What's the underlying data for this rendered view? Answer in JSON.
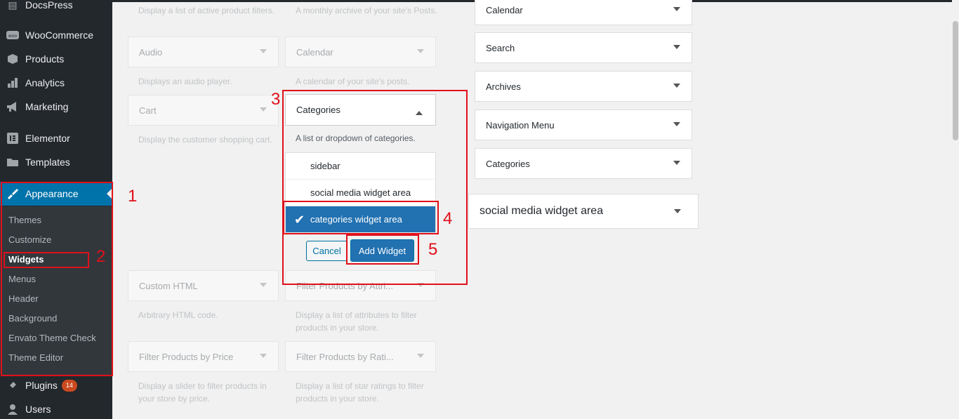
{
  "sidebar": {
    "items": [
      {
        "label": "DocsPress",
        "icon": "docs-icon"
      },
      {
        "label": "WooCommerce",
        "icon": "woo-icon"
      },
      {
        "label": "Products",
        "icon": "box-icon"
      },
      {
        "label": "Analytics",
        "icon": "bar-chart-icon"
      },
      {
        "label": "Marketing",
        "icon": "megaphone-icon"
      },
      {
        "label": "Elementor",
        "icon": "elementor-icon"
      },
      {
        "label": "Templates",
        "icon": "folder-icon"
      },
      {
        "label": "Appearance",
        "icon": "brush-icon"
      },
      {
        "label": "Plugins",
        "icon": "plug-icon",
        "badge": "14"
      },
      {
        "label": "Users",
        "icon": "user-icon"
      }
    ],
    "submenu": [
      "Themes",
      "Customize",
      "Widgets",
      "Menus",
      "Header",
      "Background",
      "Envato Theme Check",
      "Theme Editor"
    ]
  },
  "available_widgets": {
    "col1": [
      {
        "desc": "Display a list of active product filters."
      },
      {
        "title": "Audio",
        "desc": "Displays an audio player."
      },
      {
        "title": "Cart",
        "desc": "Display the customer shopping cart."
      },
      {
        "title": "Custom HTML",
        "desc": "Arbitrary HTML code."
      },
      {
        "title": "Filter Products by Price",
        "desc": "Display a slider to filter products in your store by price."
      }
    ],
    "col2": [
      {
        "desc": "A monthly archive of your site's Posts."
      },
      {
        "title": "Calendar",
        "desc": "A calendar of your site's posts."
      },
      {
        "title": "Filter Products by Attri...",
        "desc": "Display a list of attributes to filter products in your store."
      },
      {
        "title": "Filter Products by Rati...",
        "desc": "Display a list of star ratings to filter products in your store."
      }
    ]
  },
  "categories_widget": {
    "title": "Categories",
    "desc": "A list or dropdown of categories.",
    "options": [
      "sidebar",
      "social media widget area",
      "categories widget area"
    ],
    "selected": "categories widget area",
    "cancel_label": "Cancel",
    "add_label": "Add Widget"
  },
  "widget_area": {
    "widgets": [
      "Calendar",
      "Search",
      "Archives",
      "Navigation Menu",
      "Categories"
    ],
    "next_area": "social media widget area"
  },
  "annotations": [
    "1",
    "2",
    "3",
    "4",
    "5"
  ],
  "colors": {
    "accent": "#0073aa",
    "annotation": "#e0101a",
    "sidebar_bg": "#23282d"
  }
}
